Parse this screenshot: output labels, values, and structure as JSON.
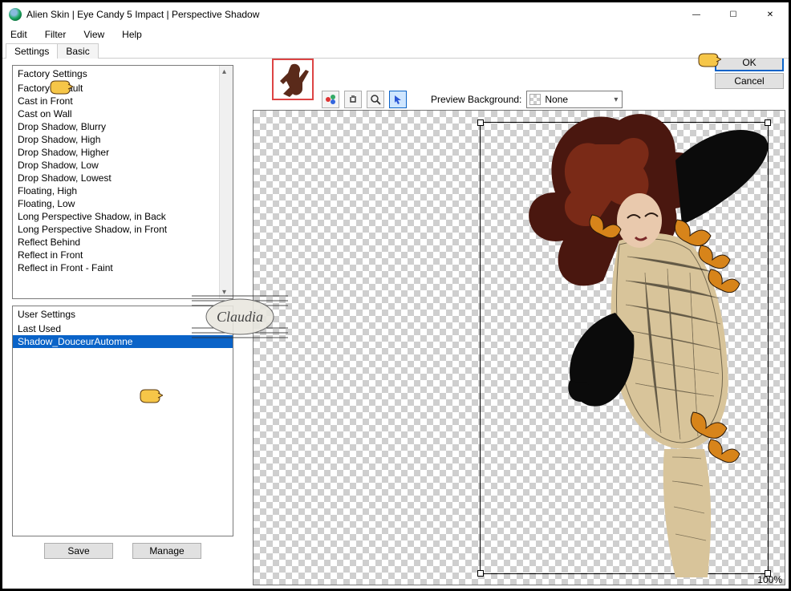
{
  "window": {
    "title": "Alien Skin | Eye Candy 5 Impact | Perspective Shadow",
    "controls": {
      "min": "—",
      "max": "☐",
      "close": "✕"
    }
  },
  "menu": {
    "edit": "Edit",
    "filter": "Filter",
    "view": "View",
    "help": "Help"
  },
  "tabs": {
    "settings": "Settings",
    "basic": "Basic"
  },
  "factory": {
    "header": "Factory Settings",
    "items": [
      "Factory Default",
      "Cast in Front",
      "Cast on Wall",
      "Drop Shadow, Blurry",
      "Drop Shadow, High",
      "Drop Shadow, Higher",
      "Drop Shadow, Low",
      "Drop Shadow, Lowest",
      "Floating, High",
      "Floating, Low",
      "Long Perspective Shadow, in Back",
      "Long Perspective Shadow, in Front",
      "Reflect Behind",
      "Reflect in Front",
      "Reflect in Front - Faint"
    ]
  },
  "user": {
    "header": "User Settings",
    "items": [
      "Last Used",
      "Shadow_DouceurAutomne"
    ],
    "selected_index": 1
  },
  "buttons": {
    "save": "Save",
    "manage": "Manage",
    "ok": "OK",
    "cancel": "Cancel"
  },
  "preview": {
    "bg_label": "Preview Background:",
    "bg_value": "None"
  },
  "status": {
    "zoom": "100%"
  },
  "watermark_text": "Claudia"
}
